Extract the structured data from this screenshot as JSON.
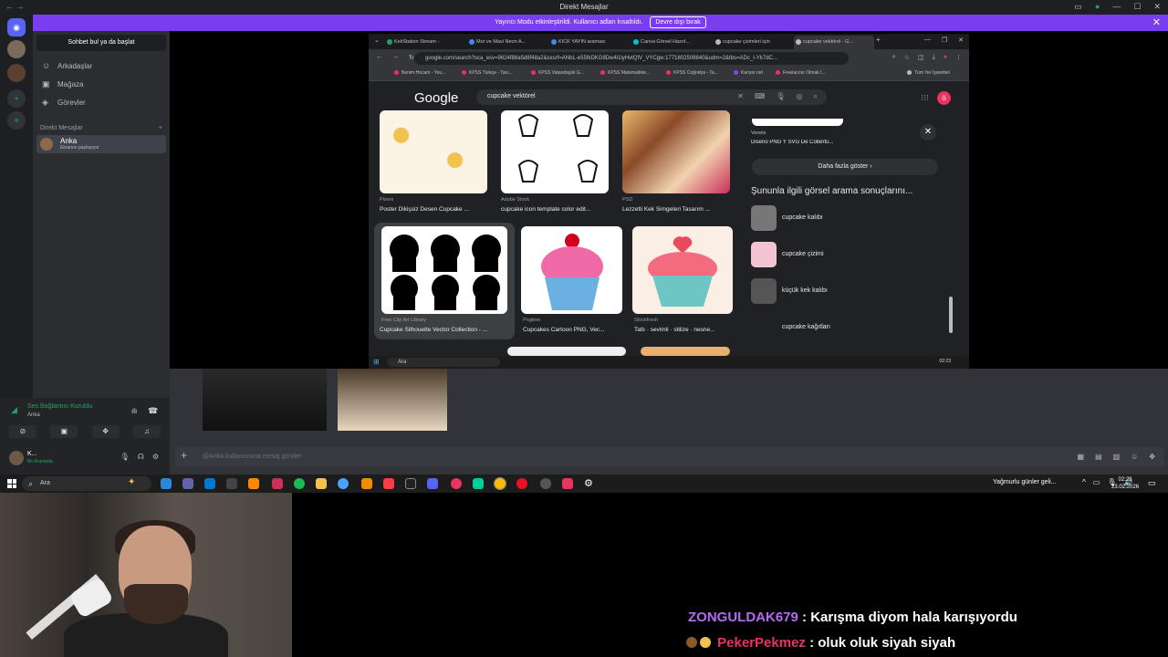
{
  "window": {
    "title": "Direkt Mesajlar"
  },
  "banner": {
    "text": "Yayıncı Modu etkinleştirildi. Kullanıcı adları kısaltıldı.",
    "button": "Devre dışı bırak"
  },
  "sidebar": {
    "search": "Sohbet bul ya da başlat",
    "nav": [
      {
        "label": "Arkadaşlar",
        "icon": "friends-icon"
      },
      {
        "label": "Mağaza",
        "icon": "store-icon"
      },
      {
        "label": "Görevler",
        "icon": "quests-icon"
      }
    ],
    "dm_header": "Direkt Mesajlar",
    "dm": {
      "name": "Anka",
      "status": "Ekranını paylaşıyor"
    }
  },
  "voice": {
    "status": "Ses Bağlantısı Kuruldu",
    "channel": "Anka"
  },
  "user": {
    "name": "K...",
    "status": "Bir Aramada"
  },
  "composer": {
    "placeholder": "@Anka kullanıcısına mesaj gönder"
  },
  "browser": {
    "tabs": [
      {
        "label": "KekStation Stream - ",
        "color": "#23a55a"
      },
      {
        "label": "Mor ve Mavi Neon A...",
        "color": "#4285f4"
      },
      {
        "label": "KICK YAYIN araması",
        "color": "#4285f4"
      },
      {
        "label": "Canva Görsel Hazırl...",
        "color": "#00c4cc"
      },
      {
        "label": "cupcake çizimleri için",
        "color": "#bbb"
      },
      {
        "label": "cupcake vektörel - G...",
        "color": "#bbb"
      }
    ],
    "url": "google.com/search?sca_esv=9624f88a5d8f48a2&sxsrf=ANbL-e55fkDKG8Dw4i1lyHvtQfV_VYCgw:1771802509840&udm=2&tbs=ADc_I-Yk7dC...",
    "bookmarks": [
      {
        "label": "Benim Hocam - You...",
        "color": "#e8345f"
      },
      {
        "label": "KPSS Türkçe - Tanı...",
        "color": "#e8345f"
      },
      {
        "label": "KPSS Vatandaşlık G...",
        "color": "#e8345f"
      },
      {
        "label": "KPSS Matematikte...",
        "color": "#e8345f"
      },
      {
        "label": "KPSS Coğrafya - Ta...",
        "color": "#e8345f"
      },
      {
        "label": "Kariyer.net",
        "color": "#8a3ffc"
      },
      {
        "label": "Freelancer Olmak İ...",
        "color": "#e8345f"
      },
      {
        "label": "Tüm Yer İşaretleri",
        "color": "#bbb"
      }
    ],
    "search_query": "cupcake vektörel",
    "avatar_letter": "ö",
    "results": [
      {
        "source": "Pixers",
        "caption": "Poster Dikişsiz Desen Cupcake ..."
      },
      {
        "source": "Adobe Stock",
        "caption": "cupcake icon template color edit..."
      },
      {
        "source": "PSD",
        "caption": "Lezzetli Kek Simgeleri Tasarım ..."
      },
      {
        "source": "Free Clip Art Library",
        "caption": "Cupcake Silhouette Vector Collection - ..."
      },
      {
        "source": "Pngtree",
        "caption": "Cupcakes Cartoon PNG, Vec..."
      },
      {
        "source": "Stockfresh",
        "caption": "Tatlı · sevimli · stilize · nesne..."
      }
    ],
    "panel": {
      "vexels_source": "Vexels",
      "vexels_caption": "Diseño PNG Y SVG De Cobertu...",
      "more": "Daha fazla göster",
      "related_header": "Şununla ilgili görsel arama sonuçlarını...",
      "related": [
        "cupcake kalıbı",
        "cupcake çizimi",
        "küçük kek kalıbı",
        "cupcake kağıtları"
      ]
    },
    "inner_taskbar": {
      "search": "Ara",
      "time": "02:23"
    }
  },
  "taskbar": {
    "search": "Ara",
    "weather": "Yağmurlu günler geli...",
    "time": "02:23",
    "date": "23.02.2026"
  },
  "chat": [
    {
      "user": "ZONGULDAK679",
      "message": ": Karışma diyom hala karışıyordu"
    },
    {
      "user": "PekerPekmez",
      "message": ": oluk oluk siyah siyah"
    }
  ]
}
